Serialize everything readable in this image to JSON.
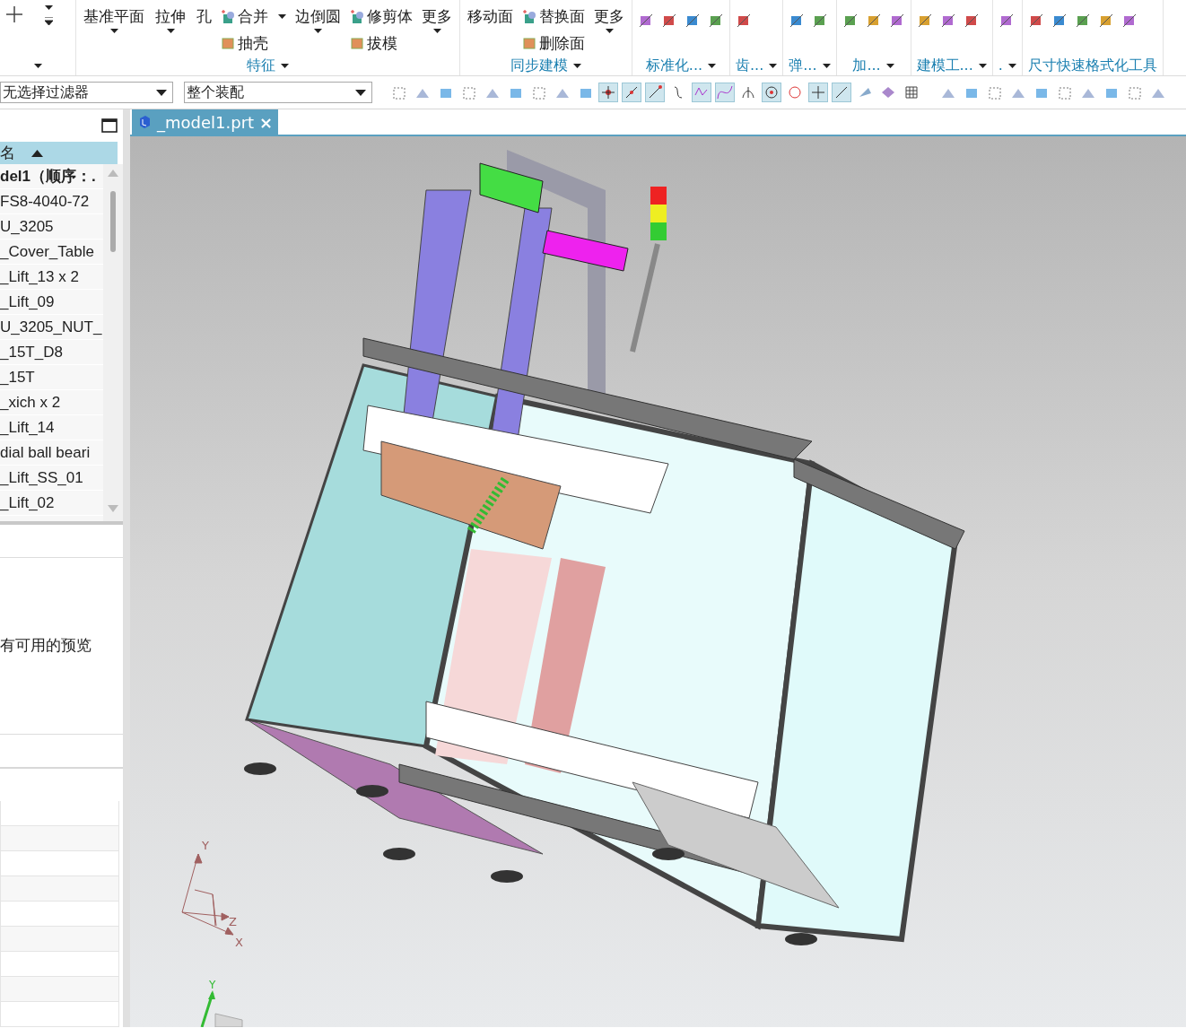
{
  "ribbon": {
    "groups": [
      {
        "kind": "partial"
      },
      {
        "kind": "buttons",
        "label": "特征",
        "items": [
          {
            "kind": "large",
            "label": "基准平面",
            "caret": true
          },
          {
            "kind": "large",
            "label": "拉伸",
            "caret": true
          },
          {
            "kind": "large",
            "label": "孔",
            "caret": false
          },
          {
            "kind": "stack",
            "items": [
              {
                "label": "合并",
                "caret": true
              },
              {
                "label": "抽壳",
                "caret": false
              }
            ]
          },
          {
            "kind": "large",
            "label": "边倒圆",
            "caret": true
          },
          {
            "kind": "stack",
            "items": [
              {
                "label": "修剪体",
                "caret": false
              },
              {
                "label": "拔模",
                "caret": false
              }
            ]
          },
          {
            "kind": "large",
            "label": "更多",
            "caret": true
          }
        ]
      },
      {
        "kind": "buttons",
        "label": "同步建模",
        "items": [
          {
            "kind": "large",
            "label": "移动面",
            "caret": false
          },
          {
            "kind": "stack",
            "items": [
              {
                "label": "替换面",
                "caret": false
              },
              {
                "label": "删除面",
                "caret": false
              }
            ]
          },
          {
            "kind": "large",
            "label": "更多",
            "caret": true
          }
        ]
      },
      {
        "kind": "icons",
        "label": "标准化..."
      },
      {
        "kind": "icons",
        "label": "齿..."
      },
      {
        "kind": "icons",
        "label": "弹..."
      },
      {
        "kind": "icons",
        "label": "加..."
      },
      {
        "kind": "icons",
        "label": "建模工..."
      },
      {
        "kind": "icons",
        "label": "."
      },
      {
        "kind": "icons",
        "label": "尺寸快速格式化工具"
      }
    ]
  },
  "toolbar": {
    "filter": "无选择过滤器",
    "scope": "整个装配",
    "snap_toggles": [
      {
        "on": true
      },
      {
        "on": true
      },
      {
        "on": true
      },
      {
        "on": false
      },
      {
        "on": true
      },
      {
        "on": true
      },
      {
        "on": false
      },
      {
        "on": true
      },
      {
        "on": false
      },
      {
        "on": true
      },
      {
        "on": true
      },
      {
        "on": false
      },
      {
        "on": false
      },
      {
        "on": false
      }
    ]
  },
  "navigator": {
    "column": "名",
    "rows": [
      {
        "label": "del1（顺序：.",
        "bold": true
      },
      {
        "label": "FS8-4040-72",
        "bold": false
      },
      {
        "label": "U_3205",
        "bold": false
      },
      {
        "label": "_Cover_Table",
        "bold": false
      },
      {
        "label": "_Lift_13 x 2",
        "bold": false
      },
      {
        "label": "_Lift_09",
        "bold": false
      },
      {
        "label": "U_3205_NUT_",
        "bold": false
      },
      {
        "label": "_15T_D8",
        "bold": false
      },
      {
        "label": "_15T",
        "bold": false
      },
      {
        "label": "_xich x 2",
        "bold": false
      },
      {
        "label": "_Lift_14",
        "bold": false
      },
      {
        "label": "dial ball beari",
        "bold": false
      },
      {
        "label": "_Lift_SS_01",
        "bold": false
      },
      {
        "label": "_Lift_02",
        "bold": false
      }
    ],
    "preview_message": "有可用的预览"
  },
  "viewport": {
    "tab": {
      "title": "_model1.prt",
      "close": "×"
    },
    "view_triad": {
      "labels": [
        "Y",
        "Z",
        "X"
      ]
    },
    "wcs_triad": {
      "labels": [
        "Y"
      ]
    }
  }
}
